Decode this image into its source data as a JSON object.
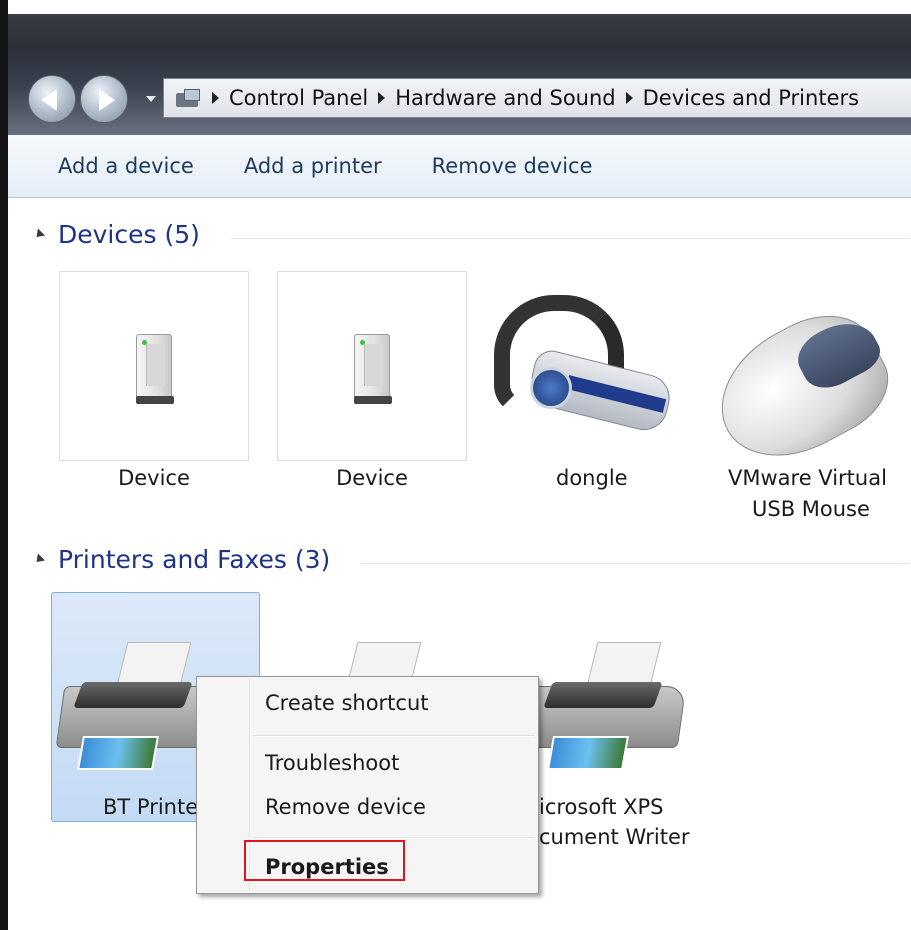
{
  "breadcrumb": {
    "items": [
      "Control Panel",
      "Hardware and Sound",
      "Devices and Printers"
    ]
  },
  "command_bar": {
    "add_device": "Add a device",
    "add_printer": "Add a printer",
    "remove_device": "Remove device"
  },
  "devices_group": {
    "title": "Devices (5)",
    "items": [
      {
        "label": "Device",
        "icon": "generic-device-icon"
      },
      {
        "label": "Device",
        "icon": "generic-device-icon"
      },
      {
        "label": "dongle",
        "icon": "headset-icon"
      },
      {
        "label_line1": "VMware Virtual",
        "label_line2": "USB Mouse",
        "icon": "mouse-icon"
      }
    ]
  },
  "printers_group": {
    "title": "Printers and Faxes (3)",
    "items": [
      {
        "label": "BT Printe",
        "icon": "printer-icon",
        "selected": true
      },
      {
        "label": "",
        "icon": "printer-icon"
      },
      {
        "label_line1": "icrosoft XPS",
        "label_line2": "cument Writer",
        "icon": "printer-icon"
      }
    ]
  },
  "context_menu": {
    "items": [
      "Create shortcut",
      "Troubleshoot",
      "Remove device",
      "Properties"
    ],
    "highlighted": "Properties",
    "highlight_color": "#e0141e"
  },
  "colors": {
    "group_header": "#1e3287",
    "selection_bg": "#c3dbf5"
  }
}
